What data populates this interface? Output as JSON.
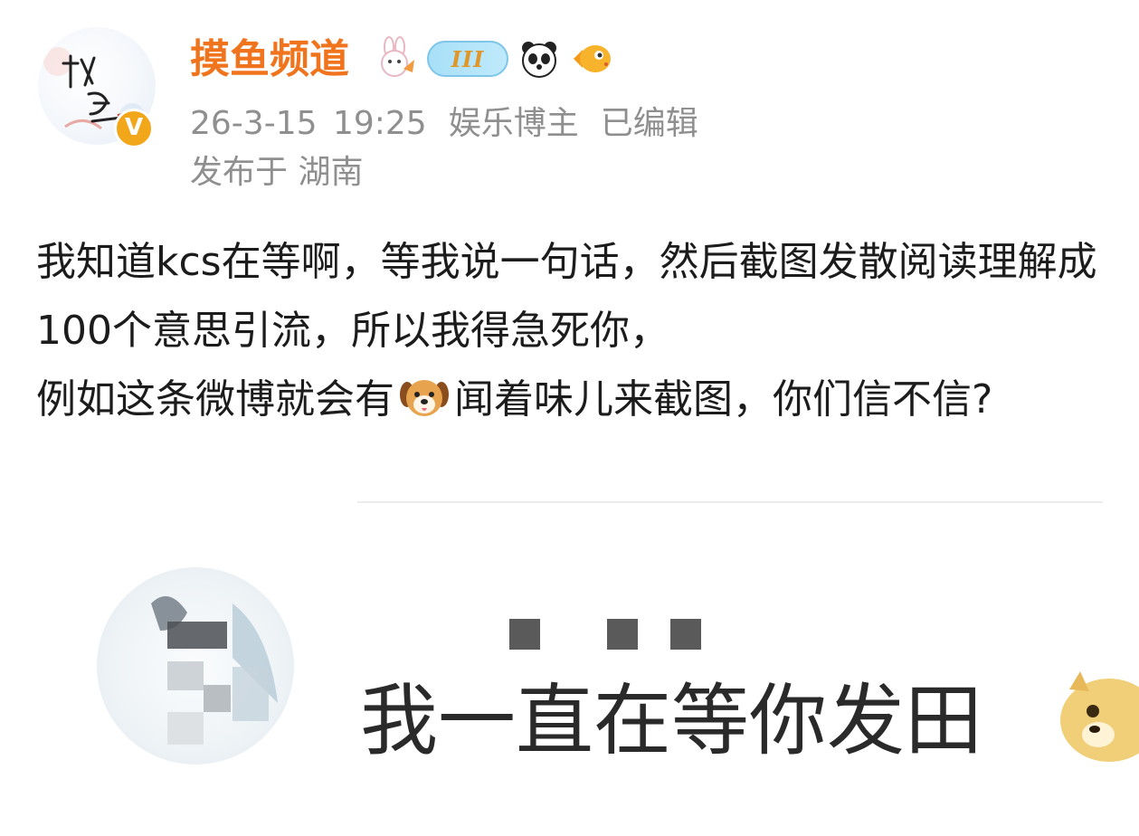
{
  "post": {
    "author": {
      "name": "摸鱼频道",
      "avatar_text": "摸鱼",
      "verified_mark": "V",
      "level_badge": "III",
      "badges": [
        "bunny-badge-icon",
        "panda-icon",
        "fish-icon"
      ]
    },
    "meta": {
      "time": "26-3-15 19:25",
      "category": "娱乐博主",
      "edited": "已编辑",
      "location": "发布于 湖南"
    },
    "content": {
      "part1": "我知道kcs在等啊，等我说一句话，然后截图发散阅读理解成100个意思引流，所以我得急死你，\n例如这条微博就会有",
      "emoji": "dog-face-icon",
      "part2": "闻着味儿来截图，你们信不信?"
    },
    "attached_image": {
      "caption": "我一直在等你发田",
      "decoration": "doge-icon"
    }
  },
  "colors": {
    "name": "#f0741d",
    "meta": "#8f8f8f",
    "text": "#1c1c1c",
    "verified": "#f2a619"
  }
}
